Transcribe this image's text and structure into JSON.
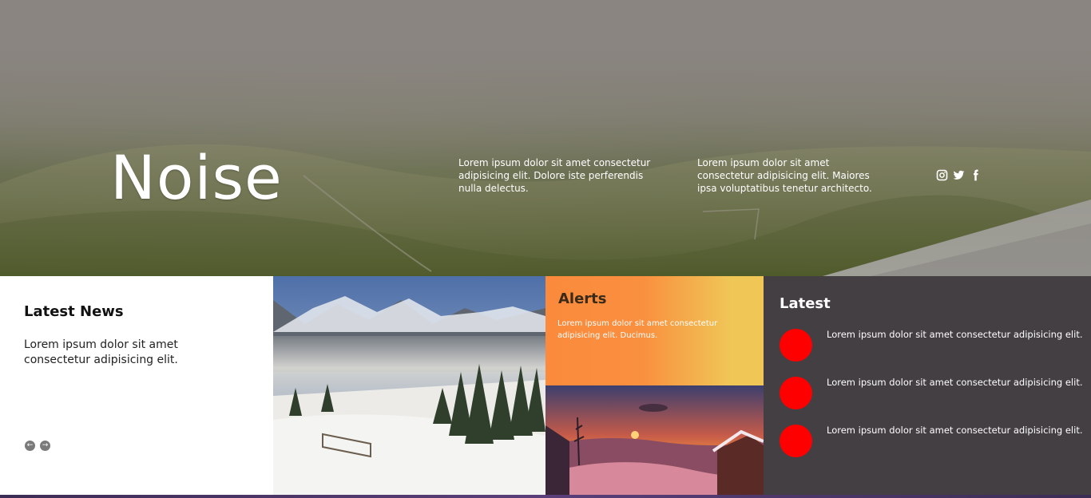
{
  "hero": {
    "logo": "Noise",
    "text_1": "Lorem ipsum dolor sit amet consectetur adipisicing elit. Dolore iste perferendis nulla delectus.",
    "text_2": "Lorem ipsum dolor sit amet consectetur adipisicing elit. Maiores ipsa voluptatibus tenetur architecto.",
    "social_icons": [
      "instagram-icon",
      "twitter-icon",
      "facebook-icon"
    ]
  },
  "news": {
    "title": "Latest News",
    "body": "Lorem ipsum dolor sit amet consectetur adipisicing elit.",
    "prev_icon": "←",
    "next_icon": "→"
  },
  "alerts": {
    "title": "Alerts",
    "body": "Lorem ipsum dolor sit amet consectetur adipisicing elit. Ducimus."
  },
  "latest": {
    "title": "Latest",
    "items": [
      "Lorem ipsum dolor sit amet consectetur adipisicing elit.",
      "Lorem ipsum dolor sit amet consectetur adipisicing elit.",
      "Lorem ipsum dolor sit amet consectetur adipisicing elit."
    ]
  },
  "colors": {
    "accent_red": "#ff0000",
    "latest_bg": "#433f42",
    "alerts_orange": "#fb8a3c",
    "alerts_yellow": "#f0c657"
  }
}
